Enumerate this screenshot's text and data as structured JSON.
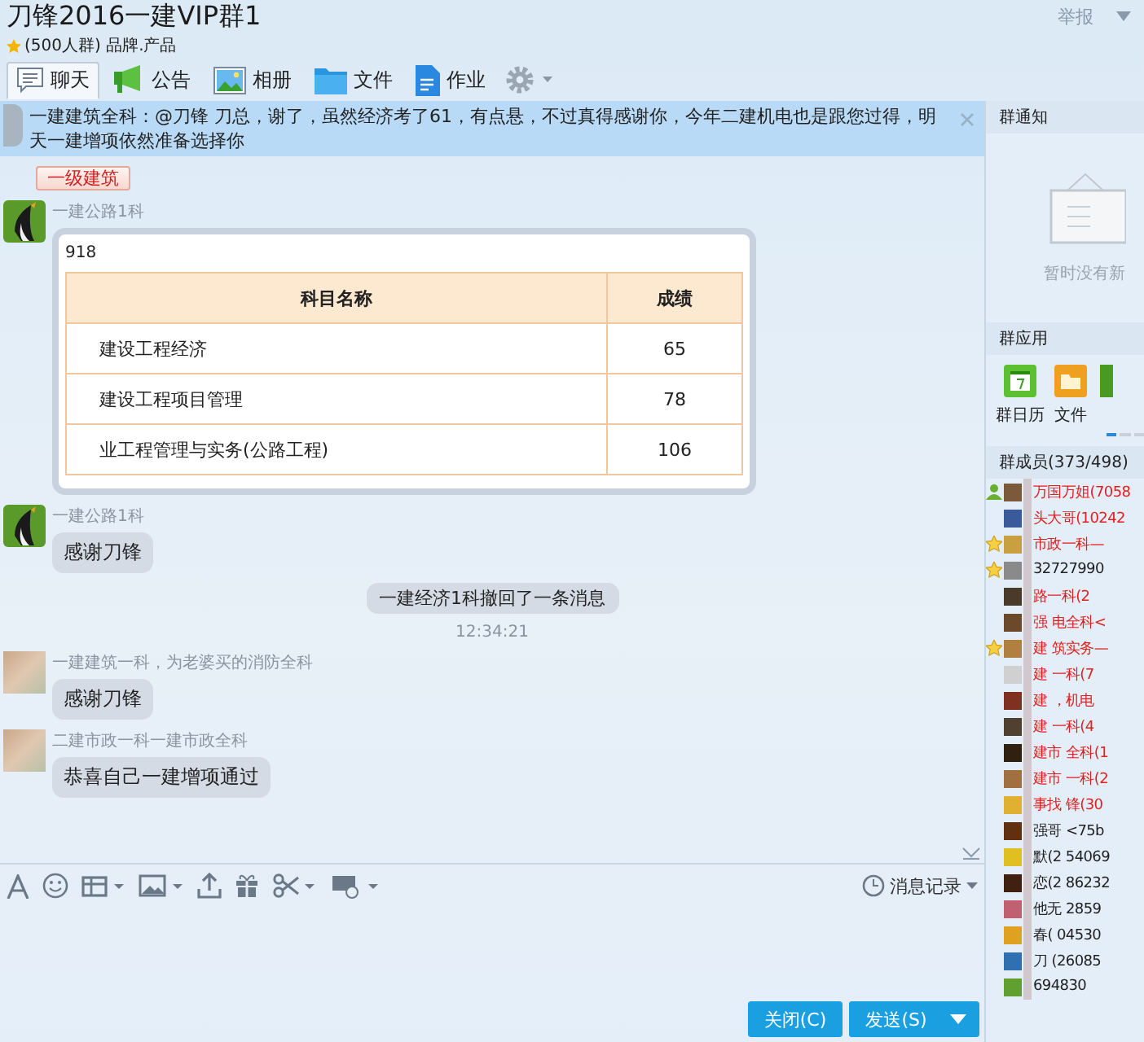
{
  "window": {
    "title": "刀锋2016一建VIP群1",
    "subtitle": "(500人群) 品牌.产品",
    "report": "举报"
  },
  "tabs": [
    {
      "label": "聊天",
      "kind": "chat",
      "selected": true
    },
    {
      "label": "公告",
      "kind": "megaphone",
      "selected": false
    },
    {
      "label": "相册",
      "kind": "photo",
      "selected": false
    },
    {
      "label": "文件",
      "kind": "folder",
      "selected": false
    },
    {
      "label": "作业",
      "kind": "document",
      "selected": false
    }
  ],
  "notification": {
    "text": "一建建筑全科：@刀锋 刀总，谢了，虽然经济考了61，有点悬，不过真得感谢你，今年二建机电也是跟您过得，明天一建增项依然准备选择你"
  },
  "messages": [
    {
      "kind": "badge",
      "text": "一级建筑"
    },
    {
      "kind": "card",
      "sender": "一建公路1科",
      "avatar_blurred": false,
      "caption": "918",
      "columns": [
        "科目名称",
        "成绩"
      ],
      "rows": [
        [
          "建设工程经济",
          "65"
        ],
        [
          "建设工程项目管理",
          "78"
        ],
        [
          "业工程管理与实务(公路工程)",
          "106"
        ]
      ]
    },
    {
      "kind": "text",
      "sender": "一建公路1科",
      "avatar_blurred": false,
      "text": "感谢刀锋"
    },
    {
      "kind": "notice",
      "text": "一建经济1科撤回了一条消息"
    },
    {
      "kind": "time",
      "text": "12:34:21"
    },
    {
      "kind": "text",
      "sender": "一建建筑一科，为老婆买的消防全科",
      "avatar_blurred": true,
      "text": "感谢刀锋"
    },
    {
      "kind": "text",
      "sender": "二建市政一科一建市政全科",
      "avatar_blurred": true,
      "text": "恭喜自己一建增项通过"
    }
  ],
  "input": {
    "history": "消息记录"
  },
  "buttons": {
    "close": "关闭(C)",
    "send": "发送(S)"
  },
  "side": {
    "notice_title": "群通知",
    "notice_empty": "暂时没有新",
    "apps_title": "群应用",
    "apps": [
      {
        "label": "群日历",
        "kind": "calendar"
      },
      {
        "label": "文件",
        "kind": "folder"
      }
    ],
    "members_title": "群成员(373/498)",
    "members": [
      {
        "name": "万国万姐(7058",
        "owner": true,
        "starred": false,
        "vip": true
      },
      {
        "name": "头大哥(10242",
        "owner": false,
        "starred": false,
        "vip": true
      },
      {
        "name": "市政一科—",
        "owner": false,
        "starred": true,
        "vip": true
      },
      {
        "name": "32727990",
        "owner": false,
        "starred": true,
        "vip": false
      },
      {
        "name": "路一科(2",
        "owner": false,
        "starred": false,
        "vip": true
      },
      {
        "name": "强 电全科<",
        "owner": false,
        "starred": false,
        "vip": true
      },
      {
        "name": "建 筑实务—",
        "owner": false,
        "starred": true,
        "vip": true
      },
      {
        "name": "建 一科(7",
        "owner": false,
        "starred": false,
        "vip": true
      },
      {
        "name": "建 ，机电",
        "owner": false,
        "starred": false,
        "vip": true
      },
      {
        "name": "建 一科(4",
        "owner": false,
        "starred": false,
        "vip": true
      },
      {
        "name": "建市 全科(1",
        "owner": false,
        "starred": false,
        "vip": true
      },
      {
        "name": "建市 一科(2",
        "owner": false,
        "starred": false,
        "vip": true
      },
      {
        "name": "事找 锋(30",
        "owner": false,
        "starred": false,
        "vip": true
      },
      {
        "name": "强哥 <75b",
        "owner": false,
        "starred": false,
        "vip": false
      },
      {
        "name": "默(2 54069",
        "owner": false,
        "starred": false,
        "vip": false
      },
      {
        "name": "恋(2 86232",
        "owner": false,
        "starred": false,
        "vip": false
      },
      {
        "name": "他无 2859",
        "owner": false,
        "starred": false,
        "vip": false
      },
      {
        "name": "春( 04530",
        "owner": false,
        "starred": false,
        "vip": false
      },
      {
        "name": "刀 (26085",
        "owner": false,
        "starred": false,
        "vip": false
      },
      {
        "name": "694830",
        "owner": false,
        "starred": false,
        "vip": false
      }
    ]
  }
}
